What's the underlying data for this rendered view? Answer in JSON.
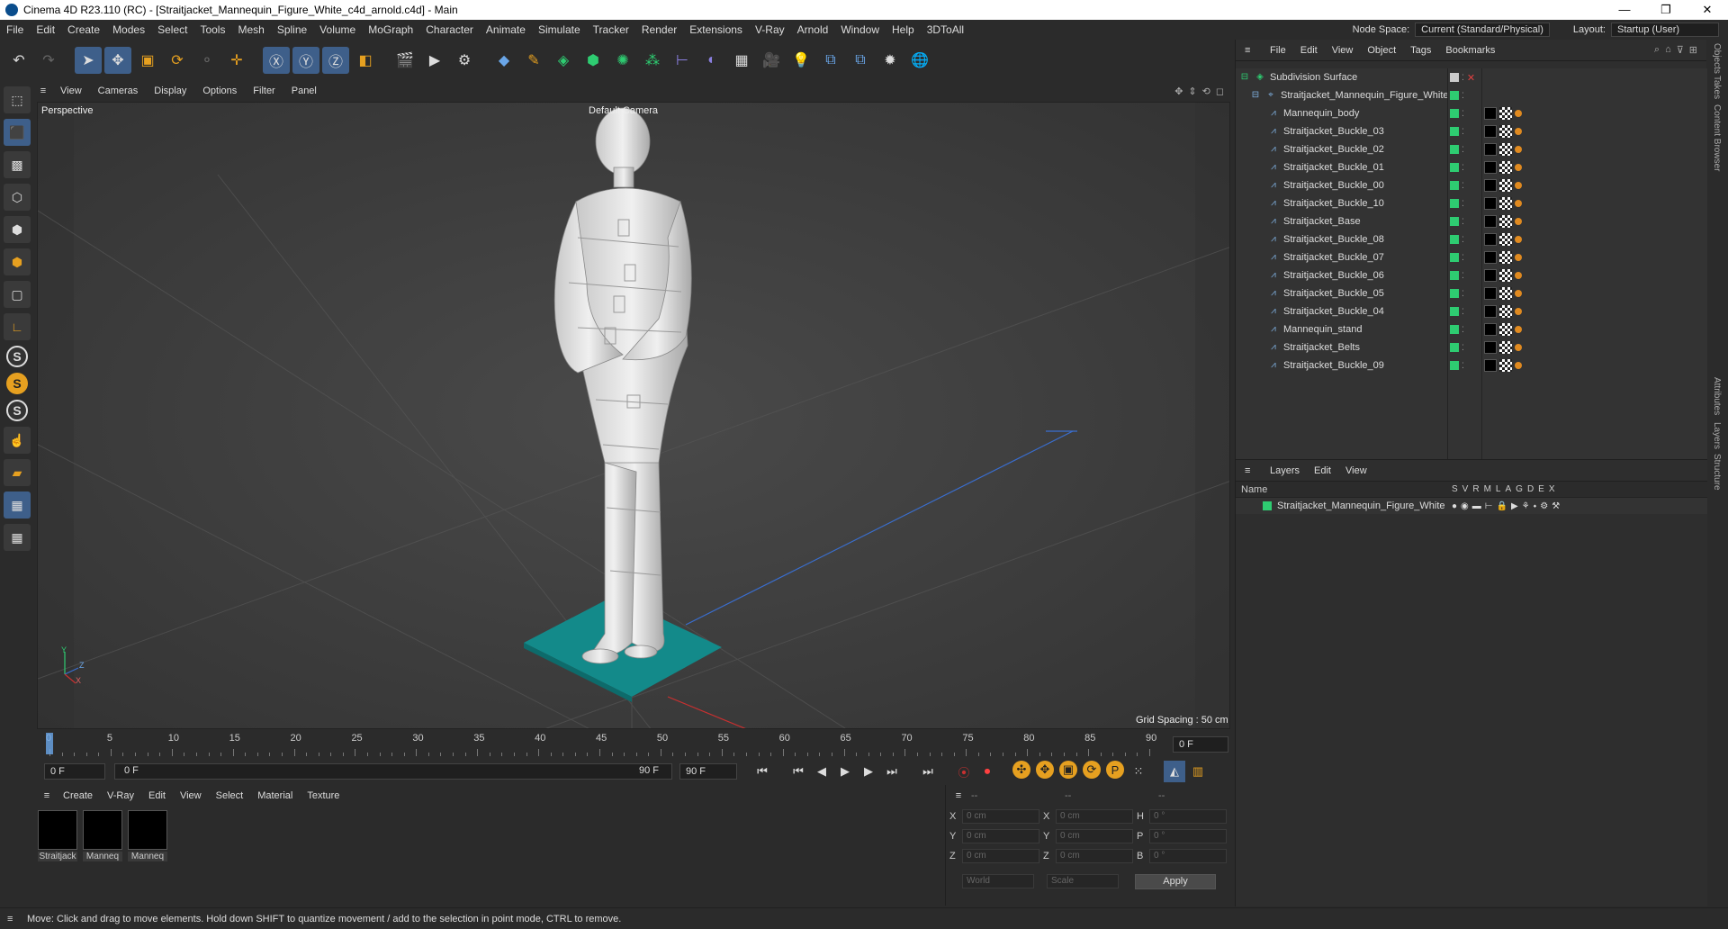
{
  "window": {
    "title": "Cinema 4D R23.110 (RC) - [Straitjacket_Mannequin_Figure_White_c4d_arnold.c4d] - Main",
    "controls": [
      "—",
      "❐",
      "✕"
    ]
  },
  "menubar": {
    "items": [
      "File",
      "Edit",
      "Create",
      "Modes",
      "Select",
      "Tools",
      "Mesh",
      "Spline",
      "Volume",
      "MoGraph",
      "Character",
      "Animate",
      "Simulate",
      "Tracker",
      "Render",
      "Extensions",
      "V-Ray",
      "Arnold",
      "Window",
      "Help",
      "3DToAll"
    ],
    "node_space_label": "Node Space:",
    "node_space_value": "Current (Standard/Physical)",
    "layout_label": "Layout:",
    "layout_value": "Startup (User)"
  },
  "viewport": {
    "menu": [
      "View",
      "Cameras",
      "Display",
      "Options",
      "Filter",
      "Panel"
    ],
    "label": "Perspective",
    "camera": "Default Camera",
    "grid_spacing": "Grid Spacing : 50 cm",
    "axis_y": "Y",
    "axis_z": "Z",
    "axis_x": "X"
  },
  "timeline": {
    "ticks": [
      "0",
      "5",
      "10",
      "15",
      "20",
      "25",
      "30",
      "35",
      "40",
      "45",
      "50",
      "55",
      "60",
      "65",
      "70",
      "75",
      "80",
      "85",
      "90"
    ],
    "frame": "0 F"
  },
  "transport": {
    "start": "0 F",
    "current": "0 F",
    "range_end": "90 F",
    "end": "90 F"
  },
  "materials": {
    "menu": [
      "Create",
      "V-Ray",
      "Edit",
      "View",
      "Select",
      "Material",
      "Texture"
    ],
    "items": [
      "Straitjack",
      "Manneq",
      "Manneq"
    ]
  },
  "coords": {
    "headers": [
      "--",
      "--",
      "--"
    ],
    "rows": [
      {
        "a": "X",
        "av": "0 cm",
        "b": "X",
        "bv": "0 cm",
        "c": "H",
        "cv": "0 °"
      },
      {
        "a": "Y",
        "av": "0 cm",
        "b": "Y",
        "bv": "0 cm",
        "c": "P",
        "cv": "0 °"
      },
      {
        "a": "Z",
        "av": "0 cm",
        "b": "Z",
        "bv": "0 cm",
        "c": "B",
        "cv": "0 °"
      }
    ],
    "world": "World",
    "scale": "Scale",
    "apply": "Apply"
  },
  "objects": {
    "menu": [
      "File",
      "Edit",
      "View",
      "Object",
      "Tags",
      "Bookmarks"
    ],
    "root": "Subdivision Surface",
    "group": "Straitjacket_Mannequin_Figure_White",
    "children": [
      "Mannequin_body",
      "Straitjacket_Buckle_03",
      "Straitjacket_Buckle_02",
      "Straitjacket_Buckle_01",
      "Straitjacket_Buckle_00",
      "Straitjacket_Buckle_10",
      "Straitjacket_Base",
      "Straitjacket_Buckle_08",
      "Straitjacket_Buckle_07",
      "Straitjacket_Buckle_06",
      "Straitjacket_Buckle_05",
      "Straitjacket_Buckle_04",
      "Mannequin_stand",
      "Straitjacket_Belts",
      "Straitjacket_Buckle_09"
    ]
  },
  "layers": {
    "menu": [
      "Layers",
      "Edit",
      "View"
    ],
    "name_header": "Name",
    "cols": [
      "S",
      "V",
      "R",
      "M",
      "L",
      "A",
      "G",
      "D",
      "E",
      "X"
    ],
    "row": "Straitjacket_Mannequin_Figure_White"
  },
  "sidetabs": [
    "Objects",
    "Takes",
    "Content Browser",
    "Attributes",
    "Layers",
    "Structure"
  ],
  "status": "Move: Click and drag to move elements. Hold down SHIFT to quantize movement / add to the selection in point mode, CTRL to remove.",
  "colors": {
    "accent": "#3e5f8a",
    "layer_green": "#2ecc71",
    "stand": "#138a8a"
  }
}
